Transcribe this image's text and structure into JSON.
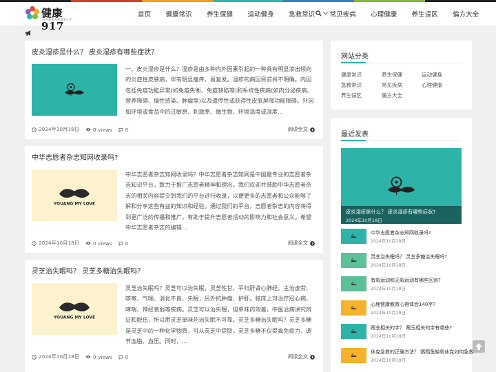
{
  "colors": {
    "topbar": [
      "#222222",
      "#d9402b",
      "#f0a020",
      "#2fb6ac",
      "#3a7fc6",
      "#82b93b",
      "#222222"
    ],
    "accent": "#2fb6ac",
    "teal_bg": "#2eb3a9",
    "cream_bg": "#fdf2cf",
    "green_bg": "#5cc098",
    "yellow_bg": "#f7b32b"
  },
  "site": {
    "brand": "健康917",
    "sub": "JIANKANG917"
  },
  "nav": {
    "items": [
      "首页",
      "健康常识",
      "养生保健",
      "运动健身",
      "急救常识",
      "常见疾病",
      "心理健康",
      "养生误区",
      "偏方大全"
    ],
    "search_icon": "search-icon",
    "dropdown_icon": "chevron-down-icon"
  },
  "notice_icon": "bullhorn-icon",
  "posts": [
    {
      "title": "皮炎湿疹是什么？ 皮炎湿疹有哪些症状？",
      "excerpt": "一、皮炎湿疹是什么？湿疹是由多种内外因素引起的一种具有明显渗出倾向的炎症性皮肤病，伴有明显瘙痒，易复发。湿疹的病因目前尚不明确。内因包括免疫功能异常(如免疫失衡、免疫缺陷等)和系统性疾病(如内分泌疾病、营养障碍、慢性感染、肿瘤等)以及遗传性或获得性皮肤屏障功能障碍。外因如环境或食品中的过敏原、刺激原、微生物、环境温度或湿度...",
      "date": "2024年10月18日",
      "views": "0 views",
      "comments": "0",
      "more": "阅读全文",
      "thumb_style": "teal"
    },
    {
      "title": "中华志愿者杂志知网收录吗?",
      "excerpt": "中华志愿者杂志知网收录吗？中华志愿者杂志知网是中国最专业的志愿者杂志知识平台，致力于推广志愿者精神和理念。我们欢迎并鼓励中华志愿者杂志的相关内容提交到我们的平台进行收录，以便更多的志愿者和公众能够了解和分享这些有益的知识和经验。通过我们的平台，志愿者杂志的内容将得到更广泛的传播和推广，有助于提升志愿者活动的影响力和社会意义。希望中华志愿者杂志的编辑...",
      "date": "2024年10月18日",
      "views": "0 views",
      "comments": "0",
      "more": "阅读全文",
      "thumb_style": "cream",
      "thumb_text": "YOUANG MY LOVE"
    },
    {
      "title": "灵芝治失眠吗？ 灵芝多糖治失眠吗？",
      "excerpt": "灵芝治失眠吗？灵芝可以治失眠，灵芝性甘、平归肝肾心肺经。主治虚劳、咳嗽、气喘、消化不良、失眠，另外抗肿瘤、护肝。临床上可治疗冠心病、哮喘、神经衰弱等疾病。灵芝可以治失眠，但单味药效差，中医治病讲究辨证和配伍，所以用灵芝单味药治失眠不可靠。灵芝多糖治失眠吗？灵芝多糖是灵芝中的一种化学物质，可从灵芝中提取。灵芝多糖不仅提高免疫力，调节血脂，血压。同时，...",
      "date": "2024年10月18日",
      "views": "0 views",
      "comments": "0",
      "more": "阅读全文",
      "thumb_style": "cream",
      "thumb_text": "YOUANG MY LOVE"
    }
  ],
  "sidebar": {
    "categories_title": "网站分类",
    "categories": [
      "健康常识",
      "养生保健",
      "运动健身",
      "急救常识",
      "常见疾病",
      "心理健康",
      "养生误区",
      "偏方大全"
    ],
    "recent_title": "最近发表",
    "featured": {
      "title": "皮炎湿疹是什么？ 皮炎湿疹有哪些症状?",
      "date": "2024年10月18日"
    },
    "recent": [
      {
        "title": "中华志愿者杂志知网收录吗?",
        "date": "2024年10月18日",
        "style": "teal"
      },
      {
        "title": "灵芝治失眠吗？ 灵芝多糖治失眠吗?",
        "date": "2024年10月18日",
        "style": "green"
      },
      {
        "title": "有氧运动和无氧运动有哪些区别?",
        "date": "2024年10月18日",
        "style": "green"
      },
      {
        "title": "心理健康教育心得体会140字?",
        "date": "2024年10月18日",
        "style": "yellow"
      },
      {
        "title": "跟芝相关的字？ 跟玉相关的字有哪些?",
        "date": "2024年10月18日",
        "style": "teal"
      },
      {
        "title": "休克急救的正确方法？ 鹦鹉鱼缺氧休克如何急救?",
        "date": "2024年10月18日",
        "style": "yellow"
      }
    ]
  },
  "totop_icon": "arrow-up-icon"
}
